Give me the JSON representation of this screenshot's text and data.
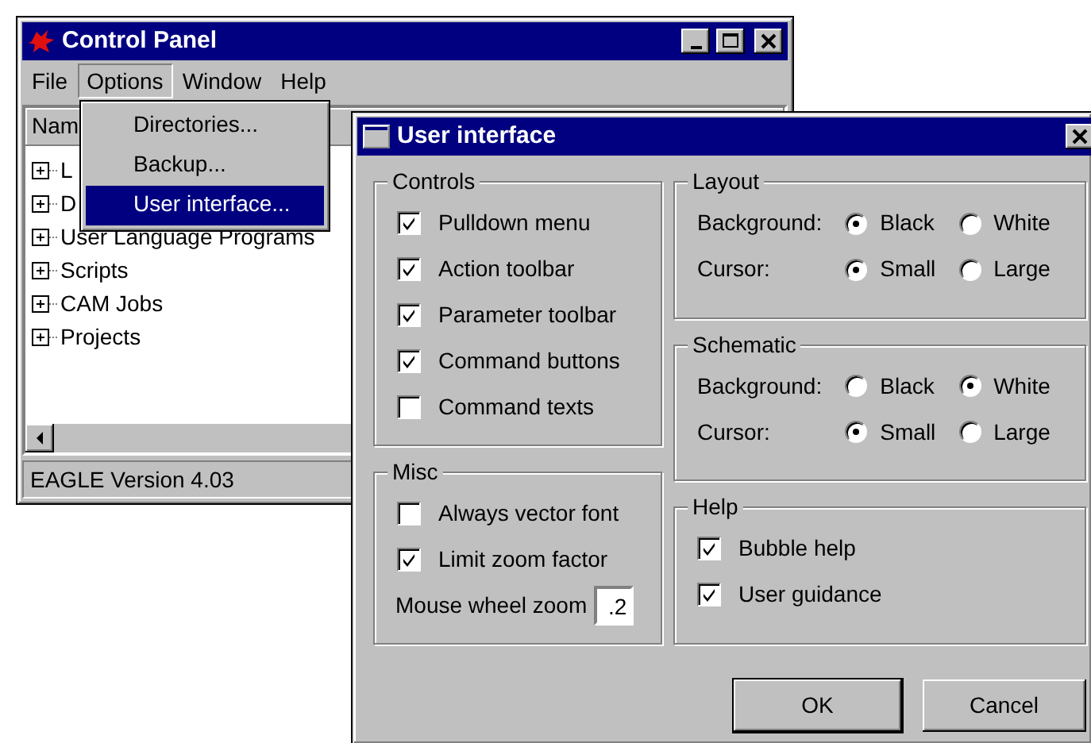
{
  "control_panel": {
    "title": "Control Panel",
    "menu": [
      {
        "label": "File",
        "selected": false
      },
      {
        "label": "Options",
        "selected": true
      },
      {
        "label": "Window",
        "selected": false
      },
      {
        "label": "Help",
        "selected": false
      }
    ],
    "column_header": "Nam",
    "tree": [
      {
        "label": "L",
        "expanded": false
      },
      {
        "label": "D",
        "expanded": false
      },
      {
        "label": "User Language Programs",
        "expanded": false
      },
      {
        "label": "Scripts",
        "expanded": false
      },
      {
        "label": "CAM Jobs",
        "expanded": false
      },
      {
        "label": "Projects",
        "expanded": false
      }
    ],
    "status_bar": "EAGLE Version 4.03"
  },
  "options_menu": [
    {
      "label": "Directories...",
      "selected": false
    },
    {
      "label": "Backup...",
      "selected": false
    },
    {
      "label": "User interface...",
      "selected": true
    }
  ],
  "dialog": {
    "title": "User interface",
    "columns": [
      [
        {
          "title": "Controls",
          "items": [
            {
              "kind": "checkbox",
              "label": "Pulldown menu",
              "checked": true
            },
            {
              "kind": "checkbox",
              "label": "Action toolbar",
              "checked": true
            },
            {
              "kind": "checkbox",
              "label": "Parameter toolbar",
              "checked": true
            },
            {
              "kind": "checkbox",
              "label": "Command buttons",
              "checked": true
            },
            {
              "kind": "checkbox",
              "label": "Command texts",
              "checked": false
            }
          ]
        },
        {
          "title": "Misc",
          "items": [
            {
              "kind": "checkbox",
              "label": "Always vector font",
              "checked": false
            },
            {
              "kind": "checkbox",
              "label": "Limit zoom factor",
              "checked": true
            },
            {
              "kind": "field",
              "label": "Mouse wheel zoom",
              "value": ".2"
            }
          ]
        }
      ],
      [
        {
          "title": "Layout",
          "items": [
            {
              "kind": "radio",
              "label": "Background:",
              "options": [
                {
                  "label": "Black",
                  "selected": true
                },
                {
                  "label": "White",
                  "selected": false
                }
              ]
            },
            {
              "kind": "radio",
              "label": "Cursor:",
              "options": [
                {
                  "label": "Small",
                  "selected": true
                },
                {
                  "label": "Large",
                  "selected": false
                }
              ]
            }
          ]
        },
        {
          "title": "Schematic",
          "items": [
            {
              "kind": "radio",
              "label": "Background:",
              "options": [
                {
                  "label": "Black",
                  "selected": false
                },
                {
                  "label": "White",
                  "selected": true
                }
              ]
            },
            {
              "kind": "radio",
              "label": "Cursor:",
              "options": [
                {
                  "label": "Small",
                  "selected": true
                },
                {
                  "label": "Large",
                  "selected": false
                }
              ]
            }
          ]
        },
        {
          "title": "Help",
          "items": [
            {
              "kind": "checkbox",
              "label": "Bubble help",
              "checked": true
            },
            {
              "kind": "checkbox",
              "label": "User guidance",
              "checked": true
            }
          ]
        }
      ]
    ],
    "buttons": [
      {
        "label": "OK",
        "default": true
      },
      {
        "label": "Cancel",
        "default": false
      }
    ]
  }
}
